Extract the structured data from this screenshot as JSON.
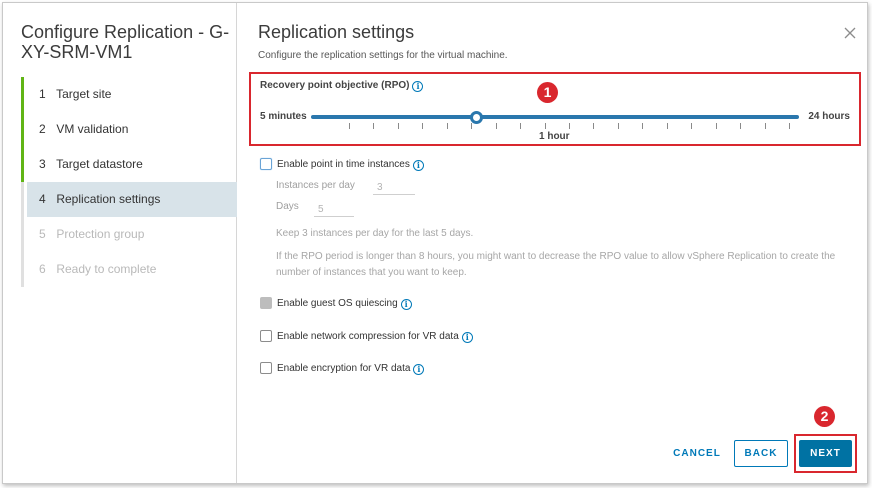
{
  "wizard": {
    "title": "Configure Replication - G-XY-SRM-VM1",
    "steps": [
      {
        "num": "1",
        "label": "Target site",
        "state": "done"
      },
      {
        "num": "2",
        "label": "VM validation",
        "state": "done"
      },
      {
        "num": "3",
        "label": "Target datastore",
        "state": "done"
      },
      {
        "num": "4",
        "label": "Replication settings",
        "state": "active"
      },
      {
        "num": "5",
        "label": "Protection group",
        "state": "disabled"
      },
      {
        "num": "6",
        "label": "Ready to complete",
        "state": "disabled"
      }
    ]
  },
  "page": {
    "title": "Replication settings",
    "subtitle": "Configure the replication settings for the virtual machine.",
    "close_icon": "close-icon"
  },
  "rpo": {
    "label": "Recovery point objective (RPO)",
    "min_label": "5 minutes",
    "max_label": "24 hours",
    "value_label": "1 hour",
    "value_fraction": 0.34,
    "tick_count": 19,
    "info_icon": "info-icon"
  },
  "annotations": {
    "badge1": "1",
    "badge2": "2",
    "color": "#d9272e"
  },
  "options": {
    "point_in_time": {
      "label": "Enable point in time instances",
      "checked": false
    },
    "instances_per_day": {
      "label": "Instances per day",
      "value": "3"
    },
    "days": {
      "label": "Days",
      "value": "5"
    },
    "note1": "Keep 3 instances per day for the last 5 days.",
    "note2": "If the RPO period is longer than 8 hours, you might want to decrease the RPO value to allow vSphere Replication to create the number of instances that you want to keep.",
    "guest_os_quiescing": {
      "label": "Enable guest OS quiescing",
      "checked": false,
      "disabled": true
    },
    "network_compression": {
      "label": "Enable network compression for VR data",
      "checked": false
    },
    "encryption": {
      "label": "Enable encryption for VR data",
      "checked": false
    }
  },
  "buttons": {
    "cancel": "CANCEL",
    "back": "BACK",
    "next": "NEXT"
  },
  "colors": {
    "accent": "#0072a3",
    "slider": "#2a77ad",
    "step_done": "#60b515",
    "step_active_bg": "#d8e3e9"
  }
}
